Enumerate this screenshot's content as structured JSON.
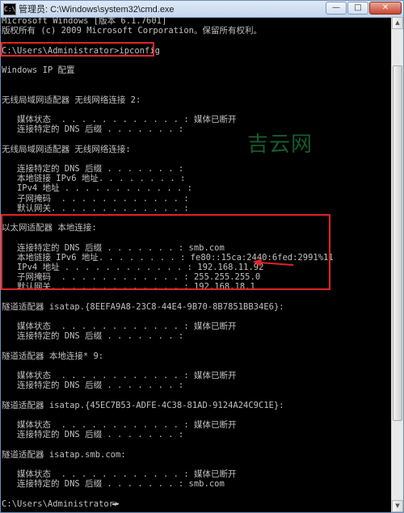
{
  "window": {
    "title": "管理员: C:\\Windows\\system32\\cmd.exe",
    "icon": "C:\\",
    "minimize": "—",
    "maximize": "□",
    "close": "✕"
  },
  "console": {
    "lines": [
      "Microsoft Windows [版本 6.1.7601]",
      "版权所有 (c) 2009 Microsoft Corporation。保留所有权利。",
      "",
      "C:\\Users\\Administrator>ipconfig",
      "",
      "Windows IP 配置",
      "",
      "",
      "无线局域网适配器 无线网络连接 2:",
      "",
      "   媒体状态  . . . . . . . . . . . . : 媒体已断开",
      "   连接特定的 DNS 后缀 . . . . . . . :",
      "",
      "无线局域网适配器 无线网络连接:",
      "",
      "   连接特定的 DNS 后缀 . . . . . . . :",
      "   本地链接 IPv6 地址. . . . . . . . :",
      "   IPv4 地址 . . . . . . . . . . . . :",
      "   子网掩码  . . . . . . . . . . . . :",
      "   默认网关. . . . . . . . . . . . . :",
      "",
      "以太网适配器 本地连接:",
      "",
      "   连接特定的 DNS 后缀 . . . . . . . : smb.com",
      "   本地链接 IPv6 地址. . . . . . . . : fe80::15ca:2440:6fed:2991%11",
      "   IPv4 地址 . . . . . . . . . . . . : 192.168.11.92",
      "   子网掩码  . . . . . . . . . . . . : 255.255.255.0",
      "   默认网关. . . . . . . . . . . . . : 192.168.18.1",
      "",
      "隧道适配器 isatap.{8EEFA9A8-23C8-44E4-9B70-8B7851BB34E6}:",
      "",
      "   媒体状态  . . . . . . . . . . . . : 媒体已断开",
      "   连接特定的 DNS 后缀 . . . . . . . :",
      "",
      "隧道适配器 本地连接* 9:",
      "",
      "   媒体状态  . . . . . . . . . . . . : 媒体已断开",
      "   连接特定的 DNS 后缀 . . . . . . . :",
      "",
      "隧道适配器 isatap.{45EC7B53-ADFE-4C38-81AD-9124A24C9C1E}:",
      "",
      "   媒体状态  . . . . . . . . . . . . : 媒体已断开",
      "   连接特定的 DNS 后缀 . . . . . . . :",
      "",
      "隧道适配器 isatap.smb.com:",
      "",
      "   媒体状态  . . . . . . . . . . . . : 媒体已断开",
      "   连接特定的 DNS 后缀 . . . . . . . : smb.com",
      "",
      "C:\\Users\\Administrator>"
    ]
  },
  "watermark": "吉云网",
  "scrollbar": {
    "up": "▲",
    "down": "▼"
  },
  "colors": {
    "highlight": "#e02424",
    "console_bg": "#000000",
    "console_text": "#c0c0c0"
  }
}
